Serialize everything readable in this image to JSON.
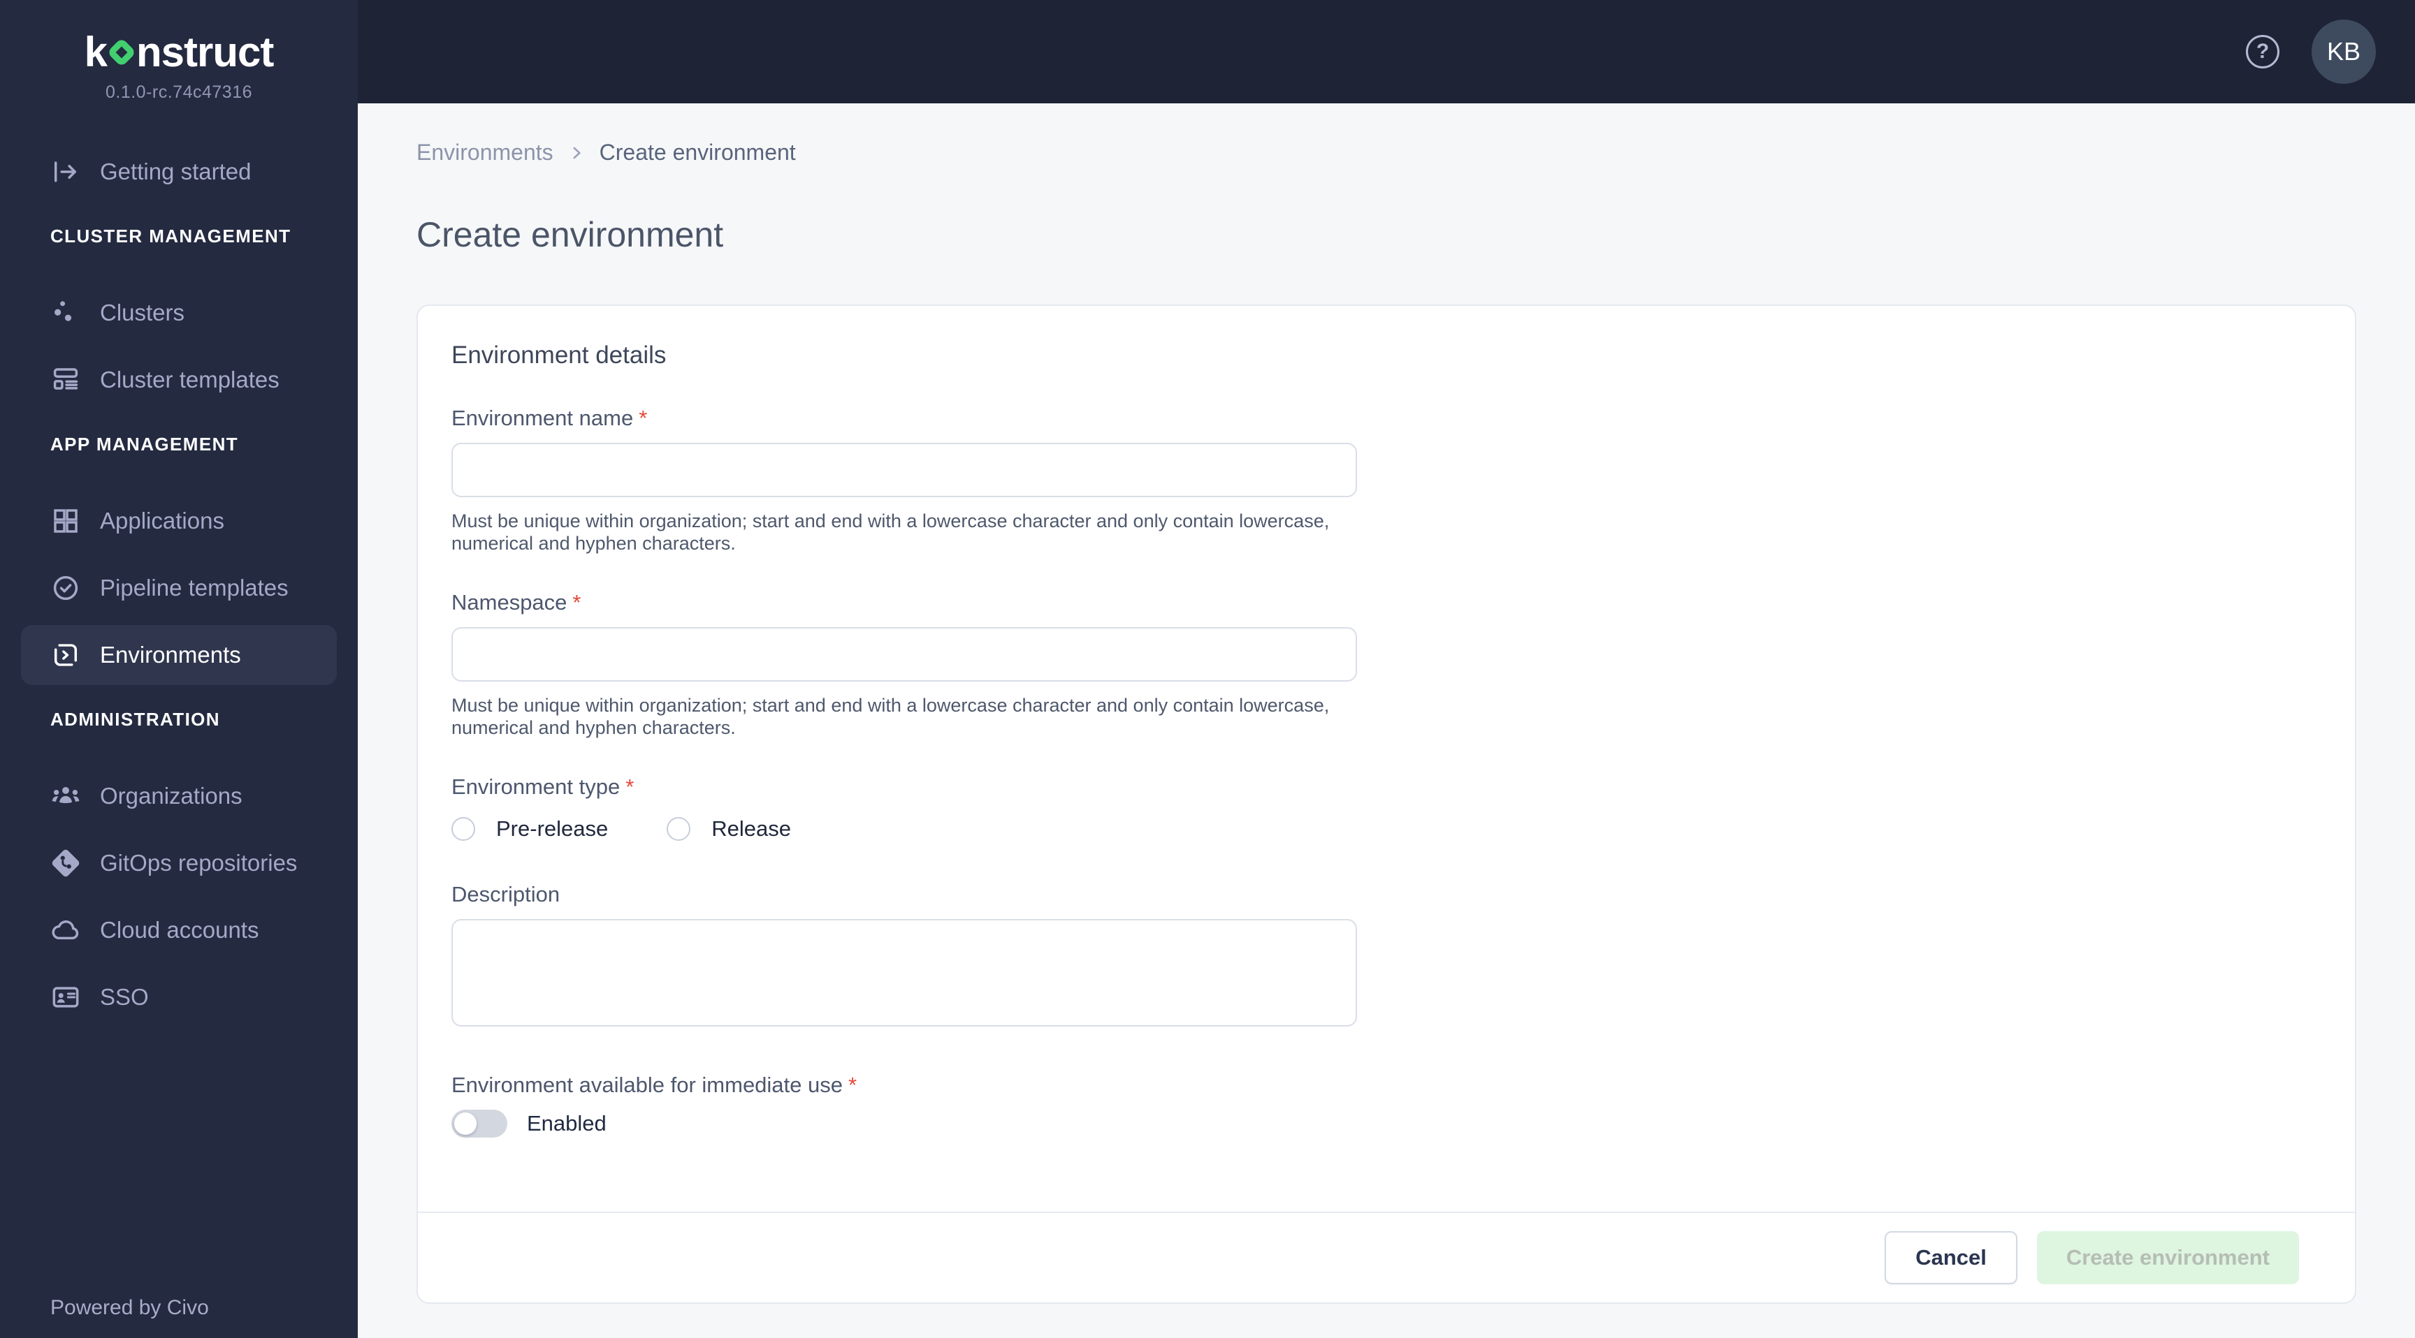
{
  "sidebar": {
    "logo": {
      "text_pre": "k",
      "text_post": "nstruct"
    },
    "version": "0.1.0-rc.74c47316",
    "getting_started": "Getting started",
    "sections": [
      {
        "heading": "CLUSTER MANAGEMENT",
        "items": [
          {
            "label": "Clusters"
          },
          {
            "label": "Cluster templates"
          }
        ]
      },
      {
        "heading": "APP MANAGEMENT",
        "items": [
          {
            "label": "Applications"
          },
          {
            "label": "Pipeline templates"
          },
          {
            "label": "Environments",
            "active": true
          }
        ]
      },
      {
        "heading": "ADMINISTRATION",
        "items": [
          {
            "label": "Organizations"
          },
          {
            "label": "GitOps repositories"
          },
          {
            "label": "Cloud accounts"
          },
          {
            "label": "SSO"
          }
        ]
      }
    ],
    "powered_by": "Powered by Civo"
  },
  "topbar": {
    "help_glyph": "?",
    "avatar_initials": "KB"
  },
  "breadcrumb": {
    "parent": "Environments",
    "current": "Create environment"
  },
  "page_title": "Create environment",
  "form": {
    "title": "Environment details",
    "environment_name": {
      "label": "Environment name",
      "required_marker": "*",
      "value": "",
      "help": "Must be unique within organization; start and end with a lowercase character and only contain lowercase, numerical and hyphen characters."
    },
    "namespace": {
      "label": "Namespace",
      "required_marker": "*",
      "value": "",
      "help": "Must be unique within organization; start and end with a lowercase character and only contain lowercase, numerical and hyphen characters."
    },
    "environment_type": {
      "label": "Environment type",
      "required_marker": "*",
      "options": [
        {
          "label": "Pre-release",
          "selected": false
        },
        {
          "label": "Release",
          "selected": false
        }
      ]
    },
    "description": {
      "label": "Description",
      "value": ""
    },
    "immediate_use": {
      "label": "Environment available for immediate use",
      "required_marker": "*",
      "toggle_label": "Enabled",
      "enabled": false
    },
    "actions": {
      "cancel": "Cancel",
      "submit": "Create environment",
      "submit_disabled": true
    }
  },
  "colors": {
    "accent_green": "#42cf6f",
    "sidebar_bg": "#242a40",
    "topbar_bg": "#1f2336",
    "content_bg": "#f6f7f9",
    "required_red": "#e14b3b",
    "disabled_submit_bg": "#def5e0"
  }
}
